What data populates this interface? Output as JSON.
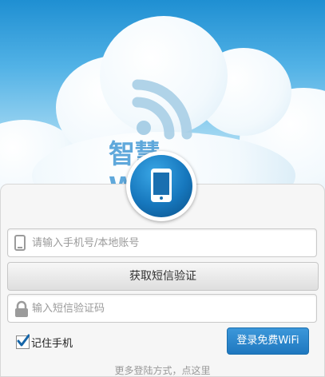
{
  "brand": {
    "title": "智慧WiFi"
  },
  "form": {
    "phone_placeholder": "请输入手机号/本地账号",
    "get_code_label": "获取短信验证",
    "code_placeholder": "输入短信验证码",
    "remember_label": "记住手机",
    "remember_checked": true,
    "login_label": "登录免费WiFi",
    "more_login_label": "更多登陆方式，点这里"
  },
  "icons": {
    "phone_badge": "mobile-phone-icon",
    "wifi": "wifi-icon",
    "phone_field": "mobile-phone-icon",
    "lock_field": "lock-icon"
  },
  "colors": {
    "accent": "#1f78bf",
    "sky_top": "#1f8fd2",
    "brand_text": "#5fa8db"
  }
}
